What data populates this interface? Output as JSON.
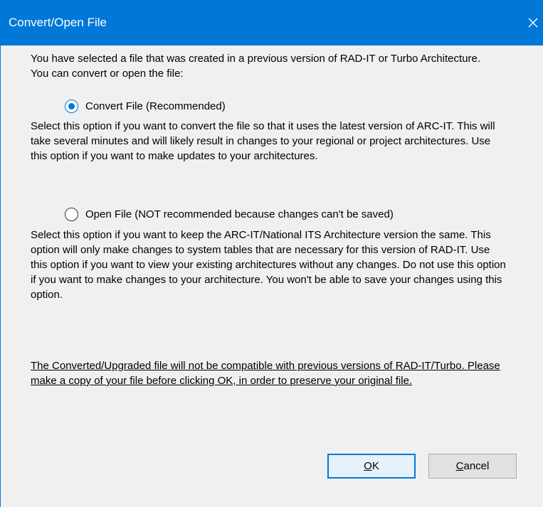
{
  "window": {
    "title": "Convert/Open File",
    "close_icon": "close-icon",
    "accent_color": "#0078d7"
  },
  "intro_text": "You have selected a file that was created in a previous version of RAD-IT or Turbo Architecture.  You can convert or open the file:",
  "options": [
    {
      "label": "Convert File (Recommended)",
      "selected": true,
      "description": "Select this option if you want to convert the file so that it uses the latest version of ARC-IT.  This will take several minutes and will likely result in changes to your regional or project architectures.  Use this option if you want to make updates to your architectures."
    },
    {
      "label": "Open File (NOT recommended because changes can't be saved)",
      "selected": false,
      "description": "Select this option if you want to keep the ARC-IT/National ITS Architecture version the same.  This option will only make changes to system tables that are necessary for this version of RAD-IT.  Use this option if you want to view your existing architectures without any changes.  Do not use this option if you want to make changes to your architecture. You won't be able to save your changes using this option."
    }
  ],
  "warning_text": "The Converted/Upgraded file will not be compatible with previous versions of RAD-IT/Turbo.  Please make a copy of your file before clicking OK, in order to preserve your original file.",
  "buttons": {
    "ok": {
      "accel": "O",
      "rest": "K"
    },
    "cancel": {
      "accel": "C",
      "rest": "ancel"
    }
  }
}
